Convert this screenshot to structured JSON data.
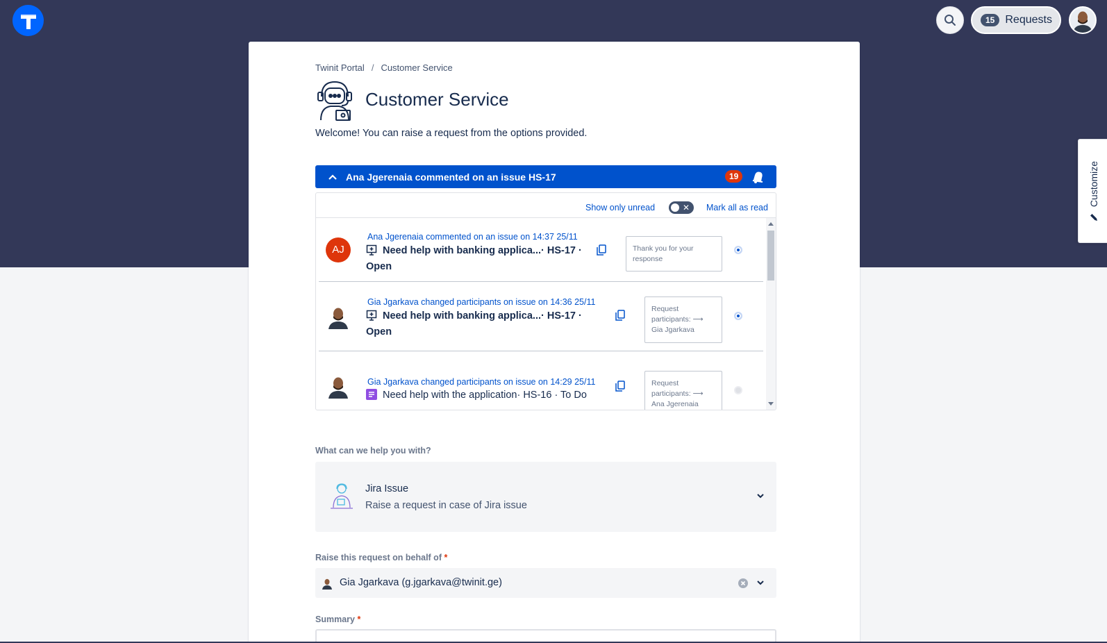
{
  "header": {
    "requests_count": "15",
    "requests_label": "Requests"
  },
  "customize_tab": {
    "label": "Customize"
  },
  "breadcrumb": {
    "portal": "Twinit Portal",
    "separator": "/",
    "current": "Customer Service"
  },
  "page": {
    "title": "Customer Service",
    "welcome": "Welcome! You can raise a request from the options provided."
  },
  "notifications": {
    "header_text": "Ana Jgerenaia commented on an issue HS-17",
    "count": "19",
    "show_only_unread_label": "Show only unread",
    "mark_all_read_label": "Mark all as read",
    "items": [
      {
        "avatar_initials": "AJ",
        "title": "Ana Jgerenaia commented on an issue on 14:37 25/11",
        "issue_line1": "Need help with banking applica...· HS-17 ·",
        "issue_line2": "Open",
        "preview": "Thank you for your response",
        "unread": true
      },
      {
        "avatar_initials": "",
        "title": "Gia Jgarkava changed participants on issue on 14:36 25/11",
        "issue_line1": "Need help with banking applica...· HS-17 ·",
        "issue_line2": "Open",
        "preview": "Request participants: ⟶ Gia Jgarkava",
        "unread": true
      },
      {
        "avatar_initials": "",
        "title": "Gia Jgarkava changed participants on issue on 14:29 25/11",
        "issue_line1": "Need help with the application· HS-16 · To Do",
        "issue_line2": "",
        "preview": "Request participants: ⟶ Ana Jgerenaia",
        "unread": false
      }
    ]
  },
  "form": {
    "help_label": "What can we help you with?",
    "help_option_title": "Jira Issue",
    "help_option_desc": "Raise a request in case of Jira issue",
    "behalf_label": "Raise this request on behalf of",
    "behalf_value": "Gia Jgarkava (g.jgarkava@twinit.ge)",
    "summary_label": "Summary",
    "required_mark": "*"
  },
  "colors": {
    "header_bg": "#333858",
    "primary": "#0052cc",
    "badge_red": "#de350b"
  },
  "icons": [
    "twinit-logo-icon",
    "search-icon",
    "user-avatar-icon",
    "pencil-icon",
    "support-agent-icon",
    "chevron-up-icon",
    "bell-icon",
    "issue-type-icon",
    "copy-icon",
    "unread-dot-icon",
    "chevron-down-icon",
    "clear-icon"
  ]
}
